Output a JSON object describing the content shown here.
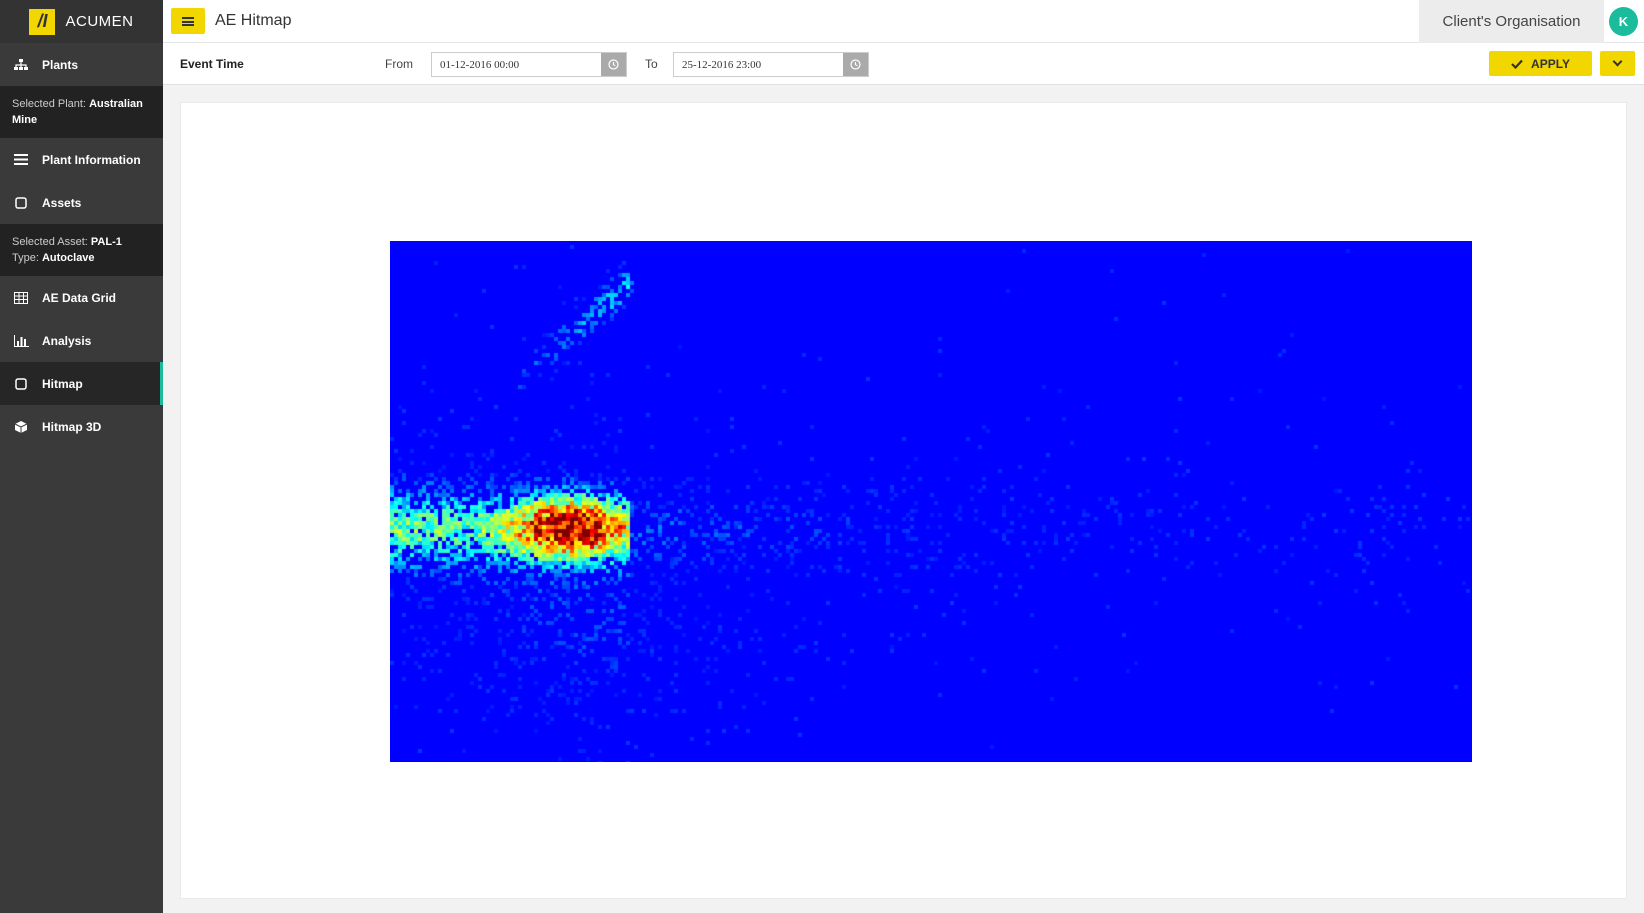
{
  "app": {
    "logo_text": "ACUMEN",
    "logo_mark": "/I"
  },
  "header": {
    "menu_icon": "hamburger-icon",
    "title": "AE Hitmap",
    "organisation": "Client's Organisation",
    "avatar_initial": "K"
  },
  "sidebar": {
    "plants_label": "Plants",
    "selected_plant_prefix": "Selected Plant: ",
    "selected_plant": "Australian Mine",
    "plant_information_label": "Plant Information",
    "assets_label": "Assets",
    "selected_asset_prefix": "Selected Asset: ",
    "selected_asset": "PAL-1",
    "type_prefix": "Type: ",
    "type": "Autoclave",
    "ae_data_grid_label": "AE Data Grid",
    "analysis_label": "Analysis",
    "hitmap_label": "Hitmap",
    "hitmap3d_label": "Hitmap 3D",
    "active_item": "Hitmap"
  },
  "filter": {
    "event_time_label": "Event Time",
    "from_label": "From",
    "from_value": "01-12-2016 00:00",
    "to_label": "To",
    "to_value": "25-12-2016 23:00",
    "apply_label": "APPLY"
  },
  "colors": {
    "accent": "#f2d600",
    "active": "#1abc9c",
    "hitmap_background": "#0000ff"
  },
  "hitmap": {
    "colormap": "jet",
    "clusters": [
      {
        "name": "main-cluster",
        "intensity": "high",
        "peak_color": "red"
      },
      {
        "name": "upper-streak",
        "intensity": "low"
      },
      {
        "name": "horizontal-spread",
        "intensity": "low"
      }
    ]
  }
}
